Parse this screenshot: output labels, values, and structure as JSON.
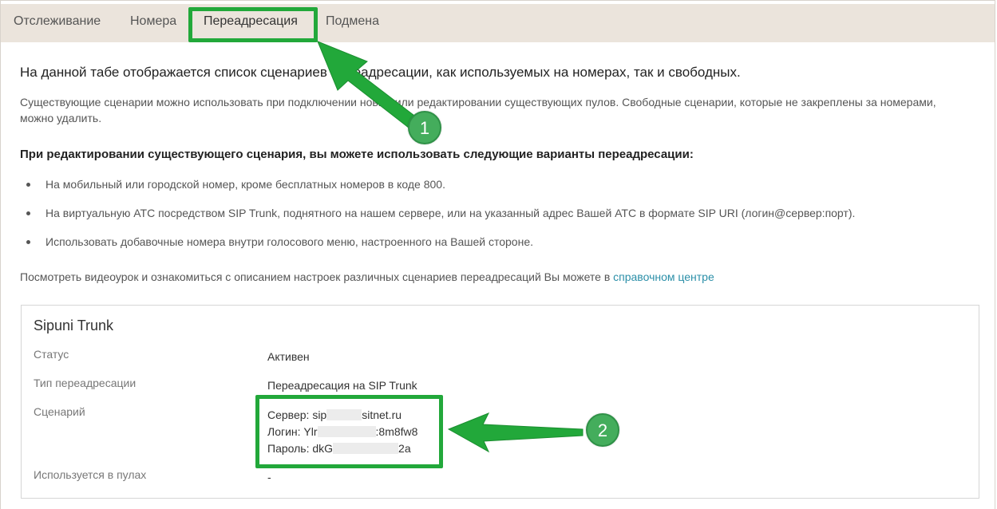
{
  "tabs": [
    {
      "label": "Отслеживание"
    },
    {
      "label": "Номера"
    },
    {
      "label": "Переадресация"
    },
    {
      "label": "Подмена"
    }
  ],
  "intro": {
    "heading": "На данной табе отображается список сценариев переадресации, как используемых на номерах, так и свободных.",
    "line1": "Существующие сценарии можно использовать при подключении новых или редактировании существующих пулов. Свободные сценарии, которые не закреплены за номерами,",
    "line2": "можно удалить.",
    "subheading": "При редактировании существующего сценария, вы можете использовать следующие варианты переадресации:",
    "bullets": [
      "На мобильный или городской номер, кроме бесплатных номеров в коде 800.",
      "На виртуальную АТС посредством SIP Trunk, поднятного на нашем сервере, или на указанный адрес Вашей АТС в формате SIP URI (логин@сервер:порт).",
      "Использовать добавочные номера внутри голосового меню, настроенного на Вашей стороне."
    ],
    "help_text": "Посмотреть видеоурок и ознакомиться с описанием настроек различных сценариев переадресаций Вы можете в",
    "help_link": "справочном центре"
  },
  "card": {
    "title": "Sipuni Trunk",
    "rows": {
      "status_label": "Статус",
      "status_value": "Активен",
      "type_label": "Тип переадресации",
      "type_value": "Переадресация на SIP Trunk",
      "scenario_label": "Сценарий",
      "server_prefix": "Сервер: sip",
      "server_suffix": "sitnet.ru",
      "login_prefix": "Логин: Ylr",
      "login_suffix": ":8m8fw8",
      "password_prefix": "Пароль: dkG",
      "password_suffix": "2a",
      "pools_label": "Используется в пулах",
      "pools_value": "-"
    }
  },
  "annotations": {
    "badge1": "1",
    "badge2": "2",
    "color": "#22a83a"
  }
}
